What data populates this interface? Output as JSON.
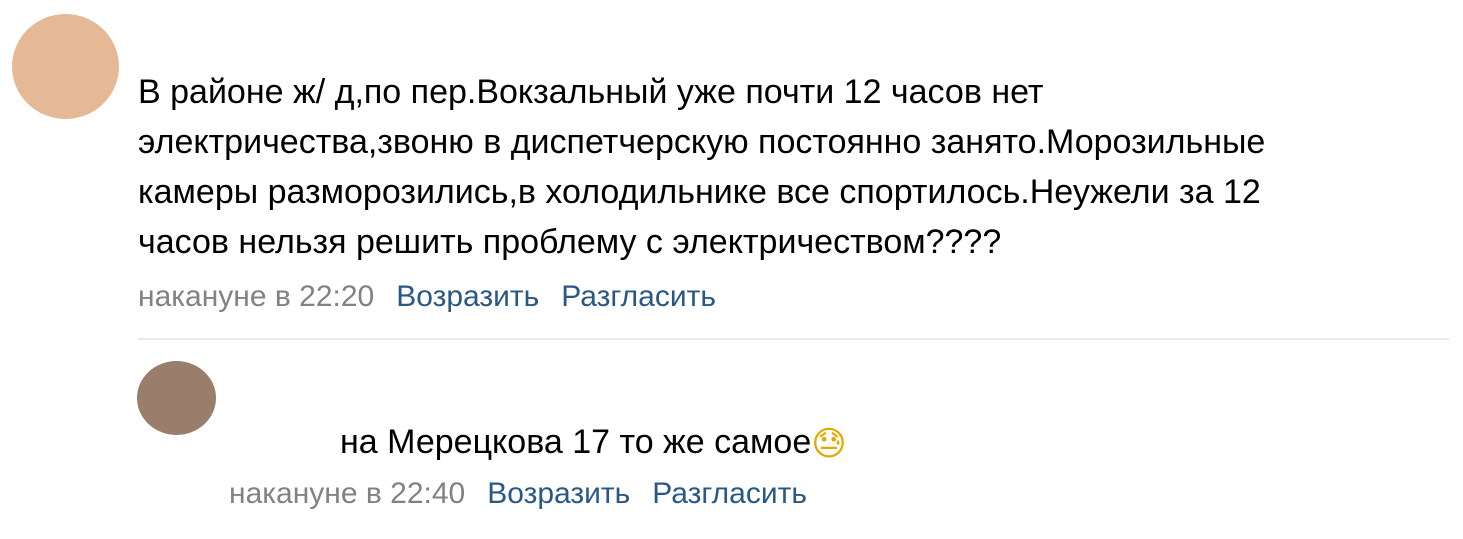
{
  "colors": {
    "avatar_1": "#e5b896",
    "avatar_2": "#9a7d6b",
    "timestamp": "#828282",
    "link": "#2a5885",
    "divider": "#e7e8ec"
  },
  "comments": [
    {
      "text": "В районе ж/ д,по пер.Вокзальный уже почти 12 часов нет\nэлектричества,звоню в диспетчерскую постоянно занято.Морозильные\nкамеры разморозились,в холодильнике все спортилось.Неужели за 12\nчасов нельзя решить проблему с электричеством????",
      "timestamp": "накануне в 22:20",
      "action_object": "Возразить",
      "action_disagree": "Разгласить"
    },
    {
      "text": "на Мерецкова 17 то же самое",
      "emoji": "😓",
      "emoji_icon": "sweat-smile-emoji-icon",
      "timestamp": "накануне в 22:40",
      "action_object": "Возразить",
      "action_disagree": "Разгласить"
    }
  ]
}
